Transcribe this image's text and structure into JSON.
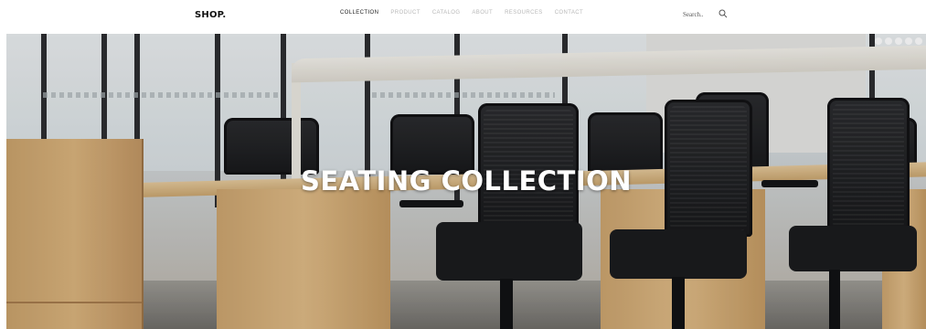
{
  "header": {
    "logo": "SHOP.",
    "nav": [
      {
        "label": "COLLECTION",
        "active": true
      },
      {
        "label": "PRODUCT",
        "active": false
      },
      {
        "label": "CATALOG",
        "active": false
      },
      {
        "label": "ABOUT",
        "active": false
      },
      {
        "label": "RESOURCES",
        "active": false
      },
      {
        "label": "CONTACT",
        "active": false
      }
    ],
    "search": {
      "placeholder": "Search..",
      "icon": "search-icon"
    }
  },
  "hero": {
    "title": "SEATING COLLECTION"
  },
  "colors": {
    "nav_active": "#222222",
    "nav_inactive": "#b9b9b9",
    "hero_title": "#ffffff"
  }
}
